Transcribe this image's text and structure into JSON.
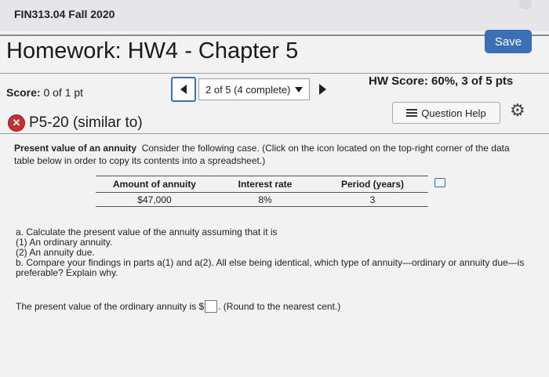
{
  "course": "FIN313.04 Fall 2020",
  "page_title": "Homework: HW4 - Chapter 5",
  "save_label": "Save",
  "score": {
    "label": "Score:",
    "value": "0 of 1 pt"
  },
  "navigator": {
    "current": "2 of 5 (4 complete)"
  },
  "hw_score": "HW Score: 60%, 3 of 5 pts",
  "question_id": "P5-20 (similar to)",
  "question_help_label": "Question Help",
  "intro": {
    "topic": "Present value of an annuity",
    "text": "Consider the following case. (Click on the icon located on the top-right corner of the data table below in order to copy its contents into a spreadsheet.)"
  },
  "table": {
    "headers": [
      "Amount of annuity",
      "Interest rate",
      "Period (years)"
    ],
    "row": [
      "$47,000",
      "8%",
      "3"
    ]
  },
  "question_parts": {
    "a": "a. Calculate the present value of the annuity assuming that it is",
    "a1": "(1) An ordinary annuity.",
    "a2": "(2) An annuity due.",
    "b": "b. Compare your findings in parts a(1) and a(2). All else being identical, which type of annuity—ordinary or annuity due—is preferable? Explain why."
  },
  "answer_prompt": {
    "before": "The present value of the ordinary annuity is $",
    "after": ". (Round to the nearest cent.)"
  },
  "icons": {
    "incorrect": "x-circle-icon",
    "question_help": "list-icon",
    "settings": "gear-icon",
    "copy_table": "copy-icon"
  },
  "colors": {
    "accent": "#3b6fb6",
    "incorrect": "#c8302f"
  }
}
